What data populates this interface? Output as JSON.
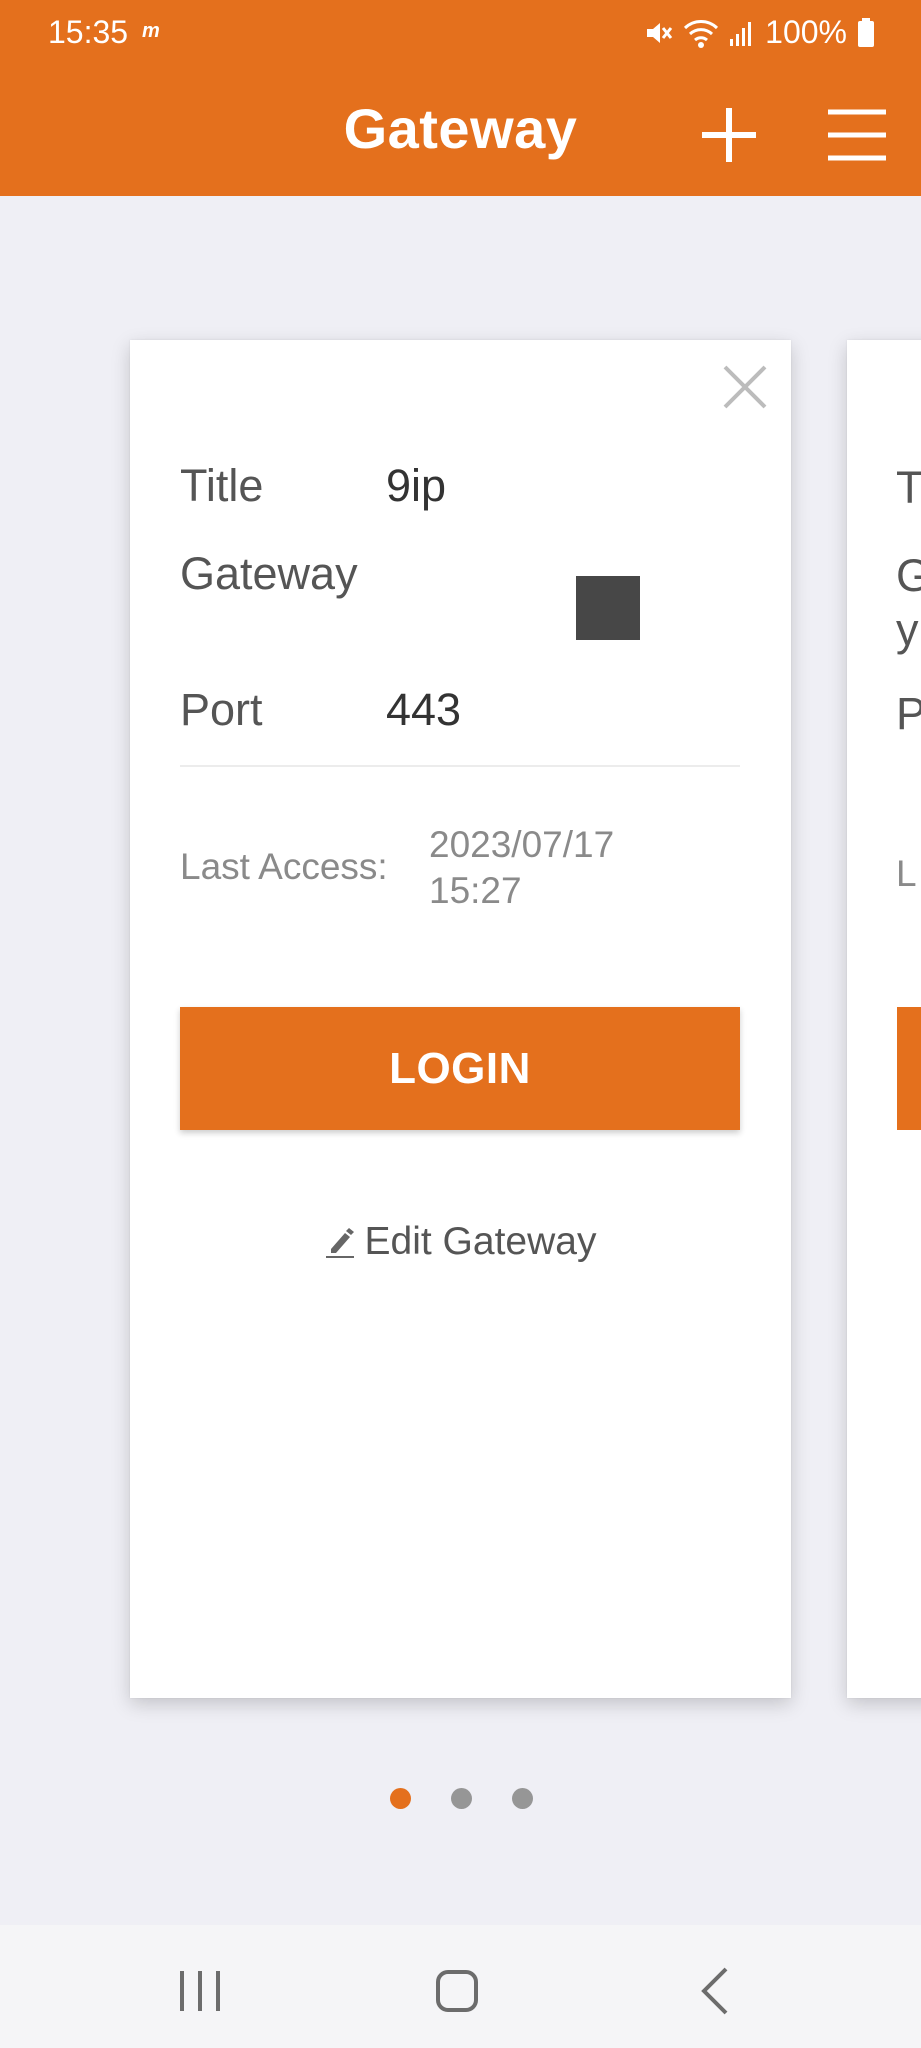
{
  "status_bar": {
    "time": "15:35",
    "carrier_icon_text": "m",
    "battery": "100%"
  },
  "header": {
    "title": "Gateway",
    "add_icon": "plus-icon",
    "menu_icon": "hamburger-icon",
    "color": "#e4701d"
  },
  "card": {
    "title_label": "Title",
    "title_value": "9ip",
    "gateway_label": "Gateway",
    "port_label": "Port",
    "port_value": "443",
    "last_access_label": "Last Access:",
    "last_access_date": "2023/07/17",
    "last_access_time": "15:27",
    "login_label": "LOGIN",
    "edit_label": "Edit Gateway"
  },
  "next_card": {
    "title_initial": "T",
    "gateway_initial_1": "G",
    "gateway_initial_2": "y",
    "port_initial": "P",
    "access_initial": "L"
  },
  "pager": {
    "pages": 3,
    "active_index": 0
  }
}
